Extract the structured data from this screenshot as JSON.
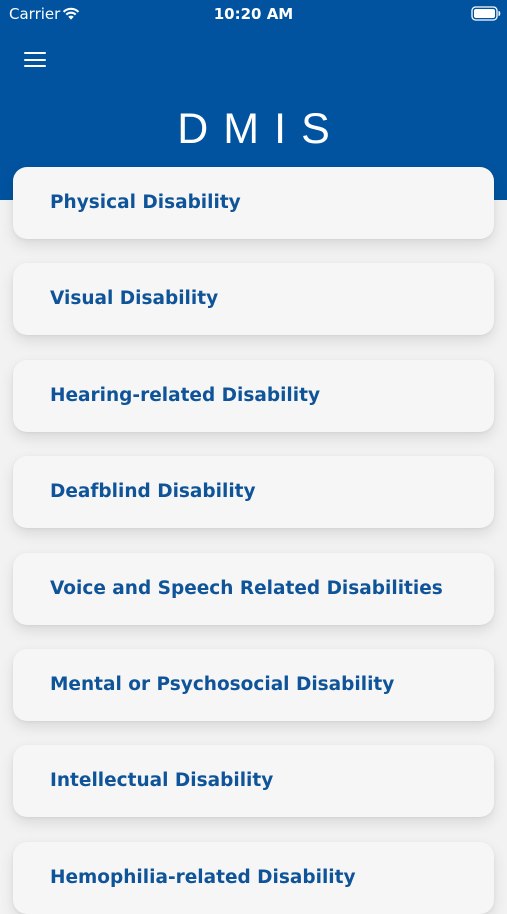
{
  "status_bar": {
    "carrier": "Carrier",
    "time": "10:20 AM",
    "wifi_icon": "wifi-icon",
    "battery_icon": "battery-icon"
  },
  "header": {
    "menu_icon": "hamburger-menu-icon",
    "title": "DMIS",
    "background_color": "#01539f"
  },
  "categories": [
    {
      "label": "Physical Disability"
    },
    {
      "label": "Visual Disability"
    },
    {
      "label": "Hearing-related Disability"
    },
    {
      "label": "Deafblind Disability"
    },
    {
      "label": "Voice and Speech Related Disabilities"
    },
    {
      "label": "Mental or Psychosocial Disability"
    },
    {
      "label": "Intellectual Disability"
    },
    {
      "label": "Hemophilia-related Disability"
    }
  ],
  "colors": {
    "accent_text": "#0f5499",
    "card_background": "#f6f6f6",
    "page_background": "#f2f2f2"
  }
}
